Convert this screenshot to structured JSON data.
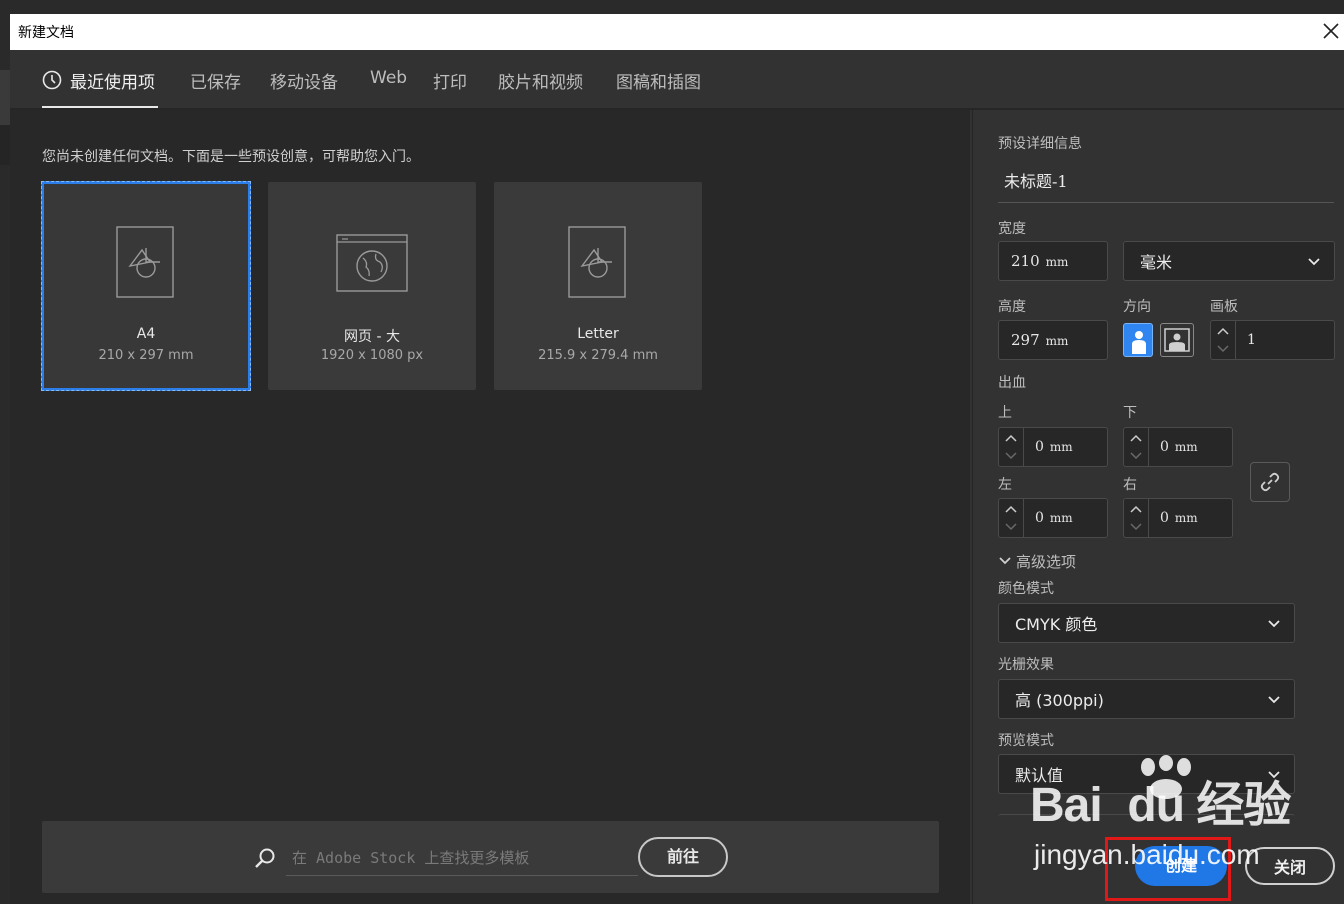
{
  "window": {
    "title": "新建文档"
  },
  "tabs": [
    {
      "label": "最近使用项",
      "active": true
    },
    {
      "label": "已保存"
    },
    {
      "label": "移动设备"
    },
    {
      "label": "Web"
    },
    {
      "label": "打印"
    },
    {
      "label": "胶片和视频"
    },
    {
      "label": "图稿和插图"
    }
  ],
  "main": {
    "hint": "您尚未创建任何文档。下面是一些预设创意，可帮助您入门。",
    "presets": [
      {
        "name": "A4",
        "size": "210 x 297 mm",
        "icon": "document-shapes-icon",
        "selected": true
      },
      {
        "name": "网页 - 大",
        "size": "1920 x 1080 px",
        "icon": "web-globe-icon"
      },
      {
        "name": "Letter",
        "size": "215.9 x 279.4 mm",
        "icon": "document-shapes-icon"
      }
    ],
    "stock": {
      "placeholder": "在 Adobe Stock 上查找更多模板",
      "go_label": "前往"
    }
  },
  "details": {
    "section_title": "预设详细信息",
    "doc_name": "未标题-1",
    "width_label": "宽度",
    "width_value": "210",
    "width_unit": "mm",
    "unit_select": "毫米",
    "height_label": "高度",
    "height_value": "297",
    "height_unit": "mm",
    "orientation_label": "方向",
    "artboard_label": "画板",
    "artboard_value": "1",
    "bleed_label": "出血",
    "bleed": {
      "top_label": "上",
      "top_value": "0",
      "top_unit": "mm",
      "bottom_label": "下",
      "bottom_value": "0",
      "bottom_unit": "mm",
      "left_label": "左",
      "left_value": "0",
      "left_unit": "mm",
      "right_label": "右",
      "right_value": "0",
      "right_unit": "mm"
    },
    "advanced_label": "高级选项",
    "color_mode_label": "颜色模式",
    "color_mode_value": "CMYK 颜色",
    "raster_label": "光栅效果",
    "raster_value": "高 (300ppi)",
    "preview_label": "预览模式",
    "preview_value": "默认值",
    "create_label": "创建",
    "close_label": "关闭"
  },
  "watermark": {
    "logo": "Bai du 经验",
    "url": "jingyan.baidu.com"
  },
  "colors": {
    "accent": "#1f78e6",
    "highlight": "#e01818",
    "panel": "#282828"
  }
}
